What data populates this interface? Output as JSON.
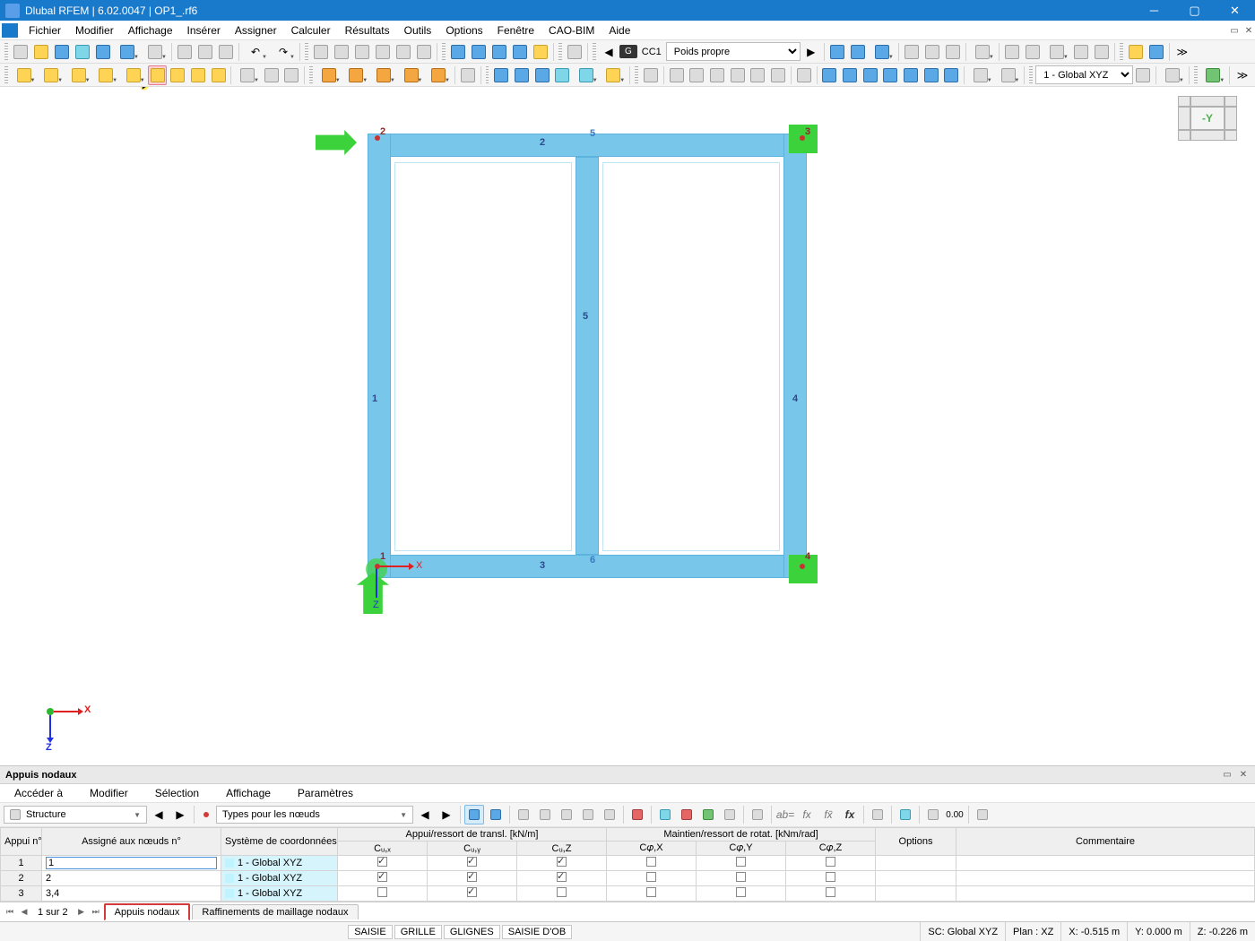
{
  "window": {
    "title": "Dlubal RFEM | 6.02.0047 | OP1_.rf6"
  },
  "menu": [
    "Fichier",
    "Modifier",
    "Affichage",
    "Insérer",
    "Assigner",
    "Calculer",
    "Résultats",
    "Outils",
    "Options",
    "Fenêtre",
    "CAO-BIM",
    "Aide"
  ],
  "toolbar1": {
    "load_case_code": "CC1",
    "load_case_name": "Poids propre",
    "cs_combo": "1 - Global XYZ"
  },
  "nav_cube_label": "-Y",
  "triad": {
    "x": "X",
    "z": "Z"
  },
  "model": {
    "nodes": {
      "n1": "1",
      "n2": "2",
      "n3": "3",
      "n4": "4",
      "n5": "5",
      "n6": "6"
    },
    "members": {
      "m1": "1",
      "m2": "2",
      "m3": "3",
      "m4": "4",
      "m5": "5"
    },
    "axis_x": "X",
    "axis_z": "Z"
  },
  "dock": {
    "title": "Appuis nodaux",
    "menu": [
      "Accéder à",
      "Modifier",
      "Sélection",
      "Affichage",
      "Paramètres"
    ],
    "left_combo": "Structure",
    "type_combo": "Types pour les nœuds",
    "header_group1": "Appui/ressort de transl. [kN/m]",
    "header_group2": "Maintien/ressort de rotat. [kNm/rad]",
    "cols": {
      "c1": "Appui n°",
      "c2": "Assigné aux nœuds n°",
      "c3": "Système de coordonnées",
      "t1": "Cᵤ,ₓ",
      "t2": "Cᵤ,ᵧ",
      "t3": "Cᵤ,Z",
      "r1": "C𝜑,X",
      "r2": "C𝜑,Y",
      "r3": "C𝜑,Z",
      "opt": "Options",
      "com": "Commentaire"
    },
    "rows": [
      {
        "id": "1",
        "nodes": "1",
        "cs": "1 - Global XYZ",
        "t": [
          true,
          true,
          true
        ],
        "r": [
          false,
          false,
          false
        ]
      },
      {
        "id": "2",
        "nodes": "2",
        "cs": "1 - Global XYZ",
        "t": [
          true,
          true,
          true
        ],
        "r": [
          false,
          false,
          false
        ]
      },
      {
        "id": "3",
        "nodes": "3,4",
        "cs": "1 - Global XYZ",
        "t": [
          false,
          true,
          false
        ],
        "r": [
          false,
          false,
          false
        ]
      }
    ],
    "sheet_info": "1 sur 2",
    "sheet_tabs": [
      "Appuis nodaux",
      "Raffinements de maillage nodaux"
    ]
  },
  "status": {
    "btns": [
      "SAISIE",
      "GRILLE",
      "GLIGNES",
      "SAISIE D'OB"
    ],
    "cs": "SC: Global XYZ",
    "plan": "Plan : XZ",
    "x": "X: -0.515 m",
    "y": "Y: 0.000 m",
    "z": "Z: -0.226 m"
  }
}
